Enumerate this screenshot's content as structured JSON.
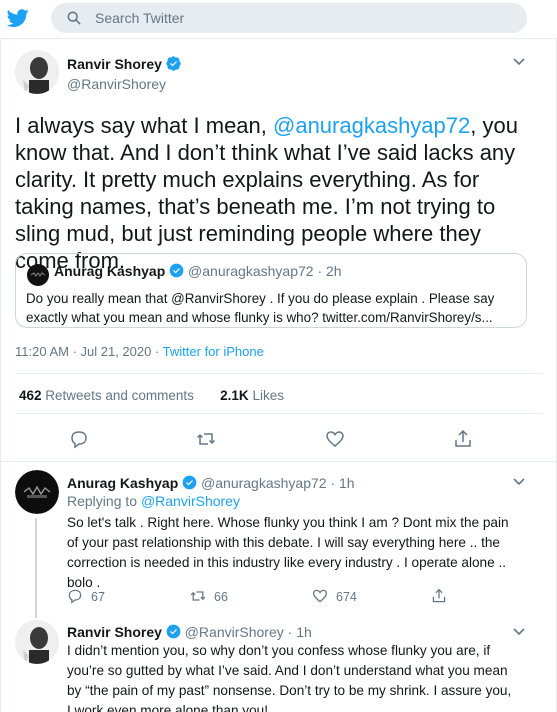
{
  "search": {
    "placeholder": "Search Twitter"
  },
  "main_tweet": {
    "author_name": "Ranvir Shorey",
    "author_handle": "@RanvirShorey",
    "text_before_mention": "I always say what I mean, ",
    "mention": "@anuragkashyap72",
    "text_after_mention": ", you know that. And I don’t think what I’ve said lacks any clarity. It pretty much explains everything. As for taking names, that’s beneath me. I’m not trying to sling mud, but just reminding people where they come from.",
    "quoted": {
      "author_name": "Anurag Kashyap",
      "author_handle": "@anuragkashyap72",
      "time": "· 2h",
      "text": "Do you really mean that @RanvirShorey . If you do please explain . Please say exactly what you mean and whose flunky is who? twitter.com/RanvirShorey/s..."
    },
    "timestamp": "11:20 AM · Jul 21, 2020 · ",
    "source": "Twitter for iPhone",
    "retweets_count": "462",
    "retweets_label": "Retweets and comments",
    "likes_count": "2.1K",
    "likes_label": "Likes"
  },
  "replies": [
    {
      "author_name": "Anurag Kashyap",
      "author_handle": "@anuragkashyap72",
      "time": "· 1h",
      "replying_label": "Replying to ",
      "replying_to": "@RanvirShorey",
      "text": "So let's talk . Right here. Whose flunky you think I am ? Dont mix the pain of your past relationship with this debate. I will say everything here .. the correction is needed in this industry like every industry . I operate alone .. bolo .",
      "reply_count": "67",
      "retweet_count": "66",
      "like_count": "674"
    },
    {
      "author_name": "Ranvir Shorey",
      "author_handle": "@RanvirShorey",
      "time": "· 1h",
      "text": "I didn’t mention you, so why don’t you confess whose flunky you are, if you’re so gutted by what I’ve said. And I don’t understand what you mean by “the pain of my past” nonsense. Don’t try to be my shrink. I assure you, I work even more alone than you!"
    }
  ],
  "colors": {
    "accent": "#1da1f2",
    "muted": "#657786",
    "text": "#14171a",
    "border": "#e6ecf0"
  }
}
